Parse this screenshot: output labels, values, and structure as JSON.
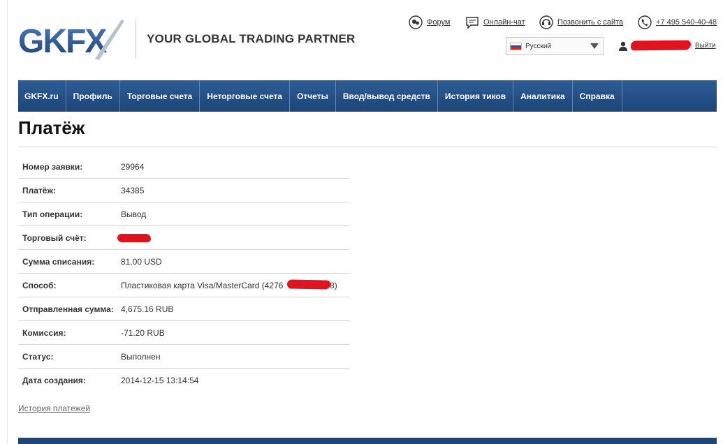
{
  "brand": {
    "logo_text": "GKFX",
    "tagline": "YOUR GLOBAL TRADING PARTNER",
    "colors": {
      "logo_blue": "#2b5a8f",
      "nav_blue": "#1d4578",
      "redaction": "#e0141e"
    }
  },
  "top_links": [
    {
      "icon": "forum-icon",
      "label": "Форум"
    },
    {
      "icon": "chat-icon",
      "label": "Онлайн-чат"
    },
    {
      "icon": "headset-icon",
      "label": "Позвонить с сайта"
    },
    {
      "icon": "phone-icon",
      "label": "+7 495 540-40-48"
    }
  ],
  "language": {
    "selected": "Русский",
    "flag": "russia-flag-icon"
  },
  "user": {
    "logout_label": "Выйти"
  },
  "nav": [
    "GKFX.ru",
    "Профиль",
    "Торговые счета",
    "Неторговые счета",
    "Отчеты",
    "Ввод/вывод средств",
    "История тиков",
    "Аналитика",
    "Справка"
  ],
  "page": {
    "title": "Платёж",
    "history_link": "История платежей"
  },
  "details": [
    {
      "label": "Номер заявки:",
      "value": "29964"
    },
    {
      "label": "Платёж:",
      "value": "34385"
    },
    {
      "label": "Тип операции:",
      "value": "Вывод"
    },
    {
      "label": "Торговый счёт:",
      "value": ""
    },
    {
      "label": "Сумма списания:",
      "value": "81.00 USD"
    },
    {
      "label": "Способ:",
      "value": "Пластиковая карта Visa/MasterCard (4276                748)"
    },
    {
      "label": "Отправленная сумма:",
      "value": "4,675.16 RUB"
    },
    {
      "label": "Комиссия:",
      "value": "-71.20 RUB"
    },
    {
      "label": "Статус:",
      "value": "Выполнен"
    },
    {
      "label": "Дата создания:",
      "value": "2014-12-15 13:14:54"
    }
  ]
}
